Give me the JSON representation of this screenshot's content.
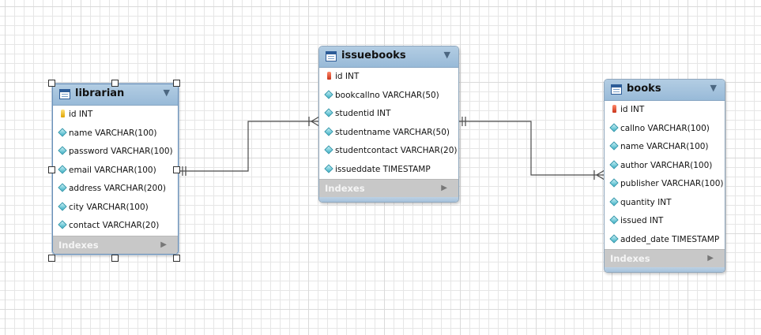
{
  "tables": {
    "librarian": {
      "name": "librarian",
      "columns": [
        "id INT",
        "name VARCHAR(100)",
        "password VARCHAR(100)",
        "email VARCHAR(100)",
        "address VARCHAR(200)",
        "city VARCHAR(100)",
        "contact VARCHAR(20)"
      ],
      "indexes_label": "Indexes"
    },
    "issuebooks": {
      "name": "issuebooks",
      "columns": [
        "id INT",
        "bookcallno VARCHAR(50)",
        "studentid INT",
        "studentname VARCHAR(50)",
        "studentcontact VARCHAR(20)",
        "issueddate TIMESTAMP"
      ],
      "indexes_label": "Indexes"
    },
    "books": {
      "name": "books",
      "columns": [
        "id INT",
        "callno VARCHAR(100)",
        "name VARCHAR(100)",
        "author VARCHAR(100)",
        "publisher VARCHAR(100)",
        "quantity INT",
        "issued INT",
        "added_date TIMESTAMP"
      ],
      "indexes_label": "Indexes"
    }
  },
  "icons": {
    "table": "table-icon",
    "collapse": "chevron-down-icon",
    "primary_key": "key-icon",
    "column": "diamond-column-icon",
    "indexes_expand": "triangle-right-icon"
  },
  "relationships": [
    {
      "from": "librarian",
      "to": "issuebooks",
      "from_end": "one",
      "to_end": "many"
    },
    {
      "from": "issuebooks",
      "to": "books",
      "from_end": "one",
      "to_end": "many"
    }
  ],
  "colors": {
    "header": "#a6c4de",
    "indexes_bar": "#c8c8c8",
    "connector": "#4a4a4a",
    "grid": "#e6e6e6"
  }
}
